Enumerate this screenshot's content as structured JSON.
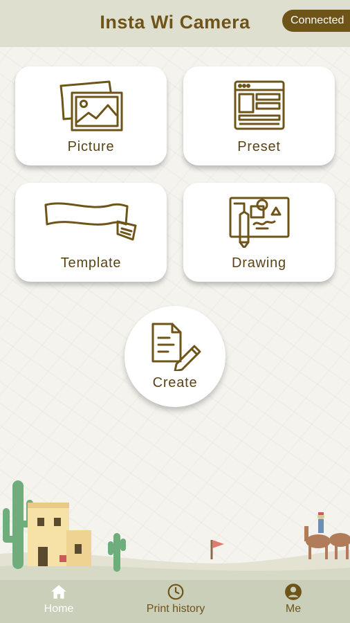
{
  "header": {
    "title": "Insta Wi Camera",
    "status_badge": "Connected"
  },
  "cards": [
    {
      "label": "Picture",
      "icon": "picture-icon"
    },
    {
      "label": "Preset",
      "icon": "preset-icon"
    },
    {
      "label": "Template",
      "icon": "template-icon"
    },
    {
      "label": "Drawing",
      "icon": "drawing-icon"
    }
  ],
  "create": {
    "label": "Create",
    "icon": "create-icon"
  },
  "nav": {
    "items": [
      {
        "label": "Home",
        "icon": "home-icon",
        "active": true
      },
      {
        "label": "Print history",
        "icon": "clock-icon",
        "active": false
      },
      {
        "label": "Me",
        "icon": "user-icon",
        "active": false
      }
    ]
  },
  "colors": {
    "accent": "#6e5418",
    "header_bg": "#dedfcf",
    "nav_bg": "#c9cfb8",
    "page_bg": "#f4f3ee"
  }
}
